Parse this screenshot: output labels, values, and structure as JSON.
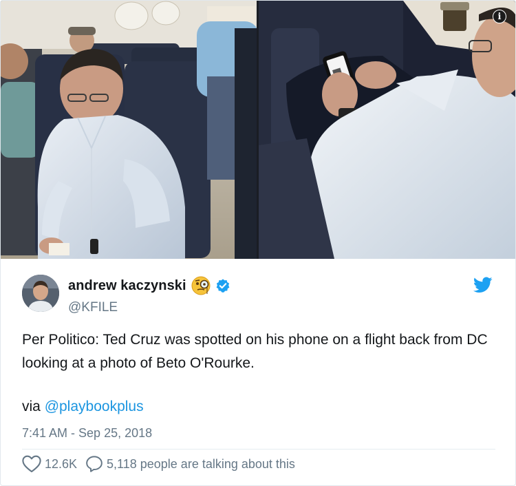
{
  "media": {
    "info_icon_glyph": "i",
    "left_photo": "passenger-reading-photo",
    "right_photo": "passenger-phone-photo"
  },
  "author": {
    "name": "andrew kaczynski",
    "handle": "@KFILE",
    "emoji_icon": "monocle-face-icon",
    "verified_icon": "verified-badge-icon",
    "avatar_icon": "avatar"
  },
  "tweet": {
    "text": "Per Politico: Ted Cruz was spotted on his phone on a flight back from DC looking at a photo of Beto O'Rourke.",
    "via_prefix": "via ",
    "via_mention": "@playbookplus",
    "timestamp": "7:41 AM - Sep 25, 2018"
  },
  "stats": {
    "likes": "12.6K",
    "conversation": "5,118 people are talking about this"
  },
  "colors": {
    "link": "#1b95e0",
    "text": "#14171a",
    "secondary": "#657786",
    "twitter_blue": "#1da1f2"
  }
}
